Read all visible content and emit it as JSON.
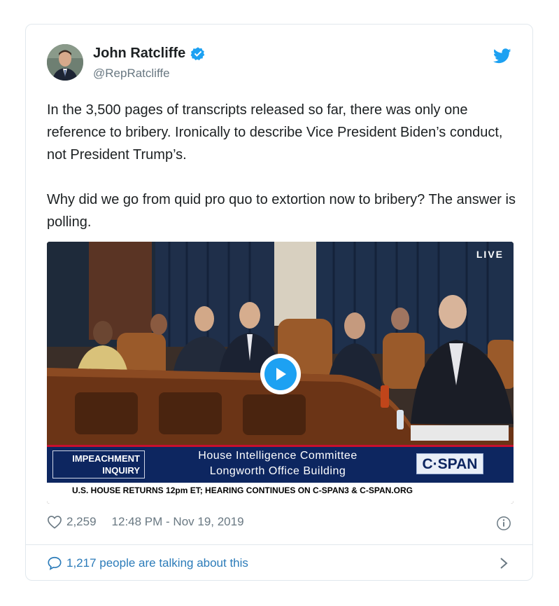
{
  "tweet": {
    "author_name": "John Ratcliffe",
    "handle": "@RepRatcliffe",
    "paragraphs": [
      "In the 3,500 pages of transcripts released so far, there was only one reference to bribery. Ironically to describe Vice President Biden’s conduct, not President Trump’s.",
      "Why did we go from quid pro quo to extortion now to bribery? The answer is polling."
    ],
    "likes": "2,259",
    "timestamp": "12:48 PM - Nov 19, 2019",
    "talking": "1,217 people are talking about this"
  },
  "media": {
    "live_label": "LIVE",
    "chyron_tag": "IMPEACHMENT INQUIRY",
    "chyron_line1": "House Intelligence Committee",
    "chyron_line2": "Longworth Office Building",
    "network": "C·SPAN",
    "ticker": "U.S. HOUSE RETURNS 12pm ET; HEARING CONTINUES ON C-SPAN3 & C-SPAN.ORG"
  },
  "colors": {
    "accent": "#1da1f2",
    "link": "#2b7bb9",
    "muted": "#697882",
    "chyron": "#0d2660"
  },
  "icons": [
    "verified-badge-icon",
    "twitter-bird-icon",
    "play-icon",
    "heart-icon",
    "info-icon",
    "speech-bubble-icon",
    "chevron-right-icon"
  ]
}
